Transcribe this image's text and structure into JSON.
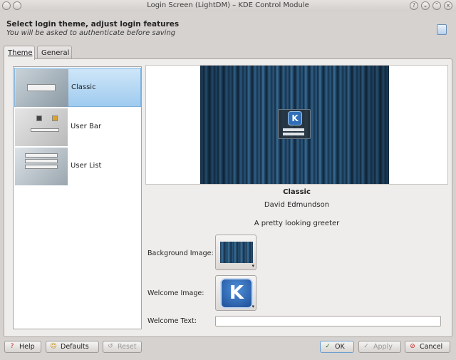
{
  "window": {
    "title": "Login Screen (LightDM) – KDE Control Module"
  },
  "header": {
    "title": "Select login theme, adjust login features",
    "subtitle": "You will be asked to authenticate before saving"
  },
  "tabs": [
    {
      "label": "Theme",
      "active": true
    },
    {
      "label": "General",
      "active": false
    }
  ],
  "themes": [
    {
      "label": "Classic",
      "selected": true
    },
    {
      "label": "User Bar",
      "selected": false
    },
    {
      "label": "User List",
      "selected": false
    }
  ],
  "details": {
    "name": "Classic",
    "author": "David Edmundson",
    "description": "A pretty looking greeter"
  },
  "fields": {
    "background_label": "Background Image:",
    "welcome_image_label": "Welcome Image:",
    "welcome_text_label": "Welcome Text:",
    "welcome_text_value": ""
  },
  "buttons": {
    "help": "Help",
    "defaults": "Defaults",
    "reset": "Reset",
    "ok": "OK",
    "apply": "Apply",
    "cancel": "Cancel"
  },
  "icons": {
    "k_glyph": "K"
  },
  "colors": {
    "selection": "#9fcbef",
    "accent": "#2f6fb7"
  }
}
